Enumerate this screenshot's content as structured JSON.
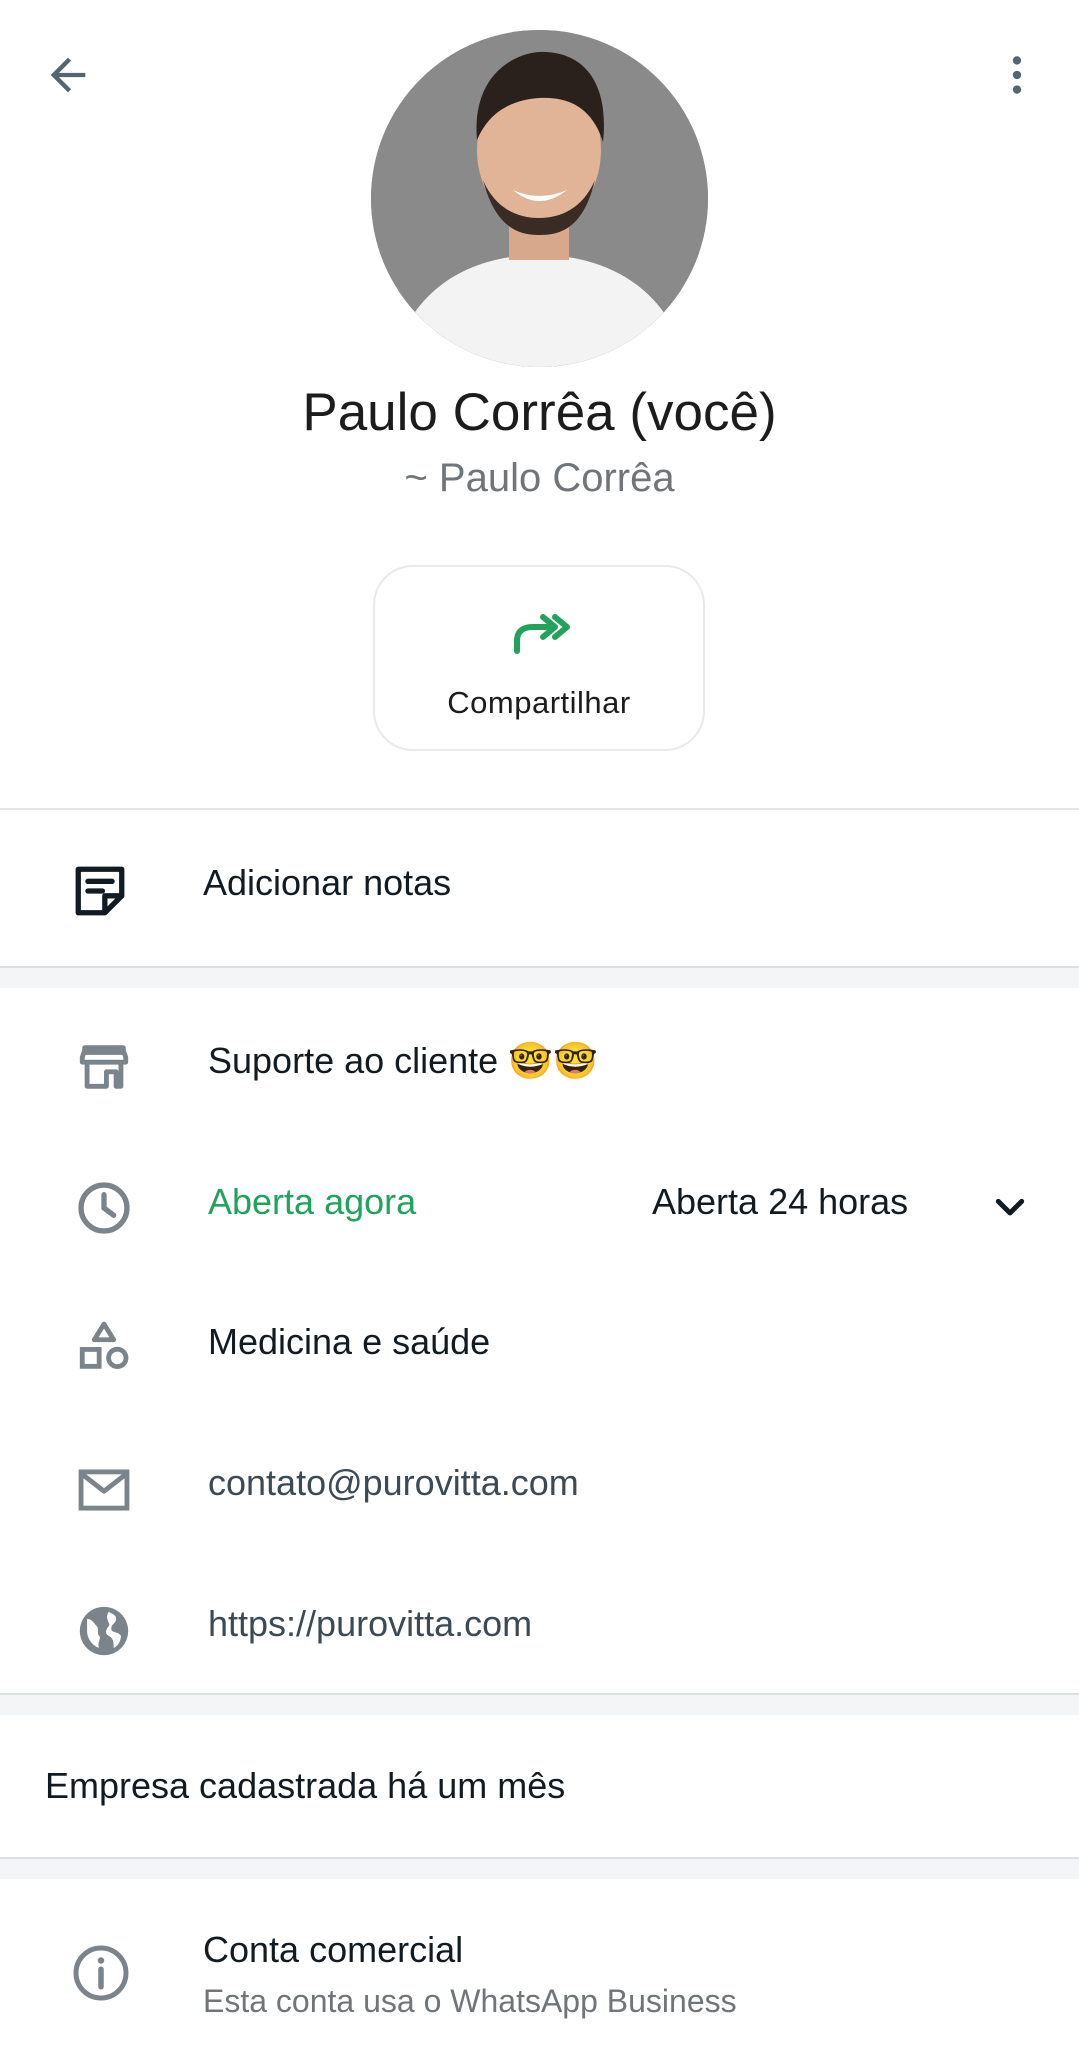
{
  "header": {
    "back_icon": "arrow-left-icon",
    "menu_icon": "more-vertical-icon"
  },
  "profile": {
    "name": "Paulo Corrêa (você)",
    "subname": "~ Paulo Corrêa"
  },
  "actions": {
    "share_label": "Compartilhar",
    "share_icon": "forward-icon"
  },
  "notes": {
    "label": "Adicionar notas",
    "icon": "note-icon"
  },
  "business": {
    "description": "Suporte ao cliente 🤓🤓",
    "status": "Aberta agora",
    "hours": "Aberta 24 horas",
    "category": "Medicina e saúde",
    "email": "contato@purovitta.com",
    "website": "https://purovitta.com"
  },
  "registered": {
    "text": "Empresa cadastrada há um mês"
  },
  "account": {
    "title": "Conta comercial",
    "subtitle": "Esta conta usa o WhatsApp Business"
  },
  "colors": {
    "accent_green": "#21a35c",
    "icon_grey": "#7a848a"
  }
}
